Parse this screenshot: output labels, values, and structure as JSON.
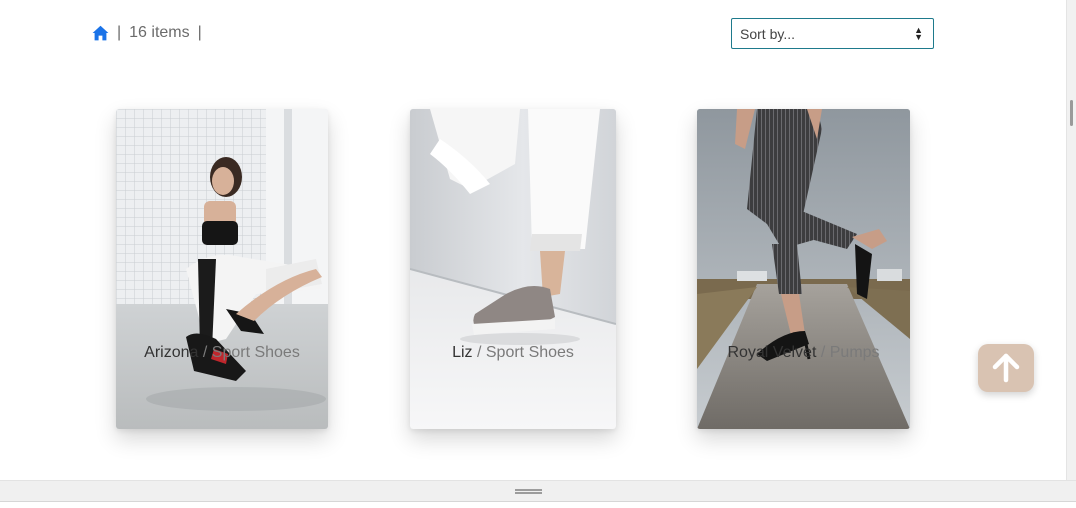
{
  "header": {
    "home_icon": "home-icon",
    "sep_left": "|",
    "items_count": "16 items",
    "sep_right": "|"
  },
  "sort": {
    "selected": "Sort by..."
  },
  "products": [
    {
      "name": "Arizona",
      "separator": "/",
      "category": "Sport Shoes"
    },
    {
      "name": "Liz",
      "separator": "/",
      "category": "Sport Shoes"
    },
    {
      "name": "Royal Velvet",
      "separator": "/",
      "category": "Pumps"
    }
  ],
  "colors": {
    "accent_blue": "#1a73e8",
    "select_border": "#1e7a8c",
    "to_top_bg": "#d9c3b2"
  }
}
